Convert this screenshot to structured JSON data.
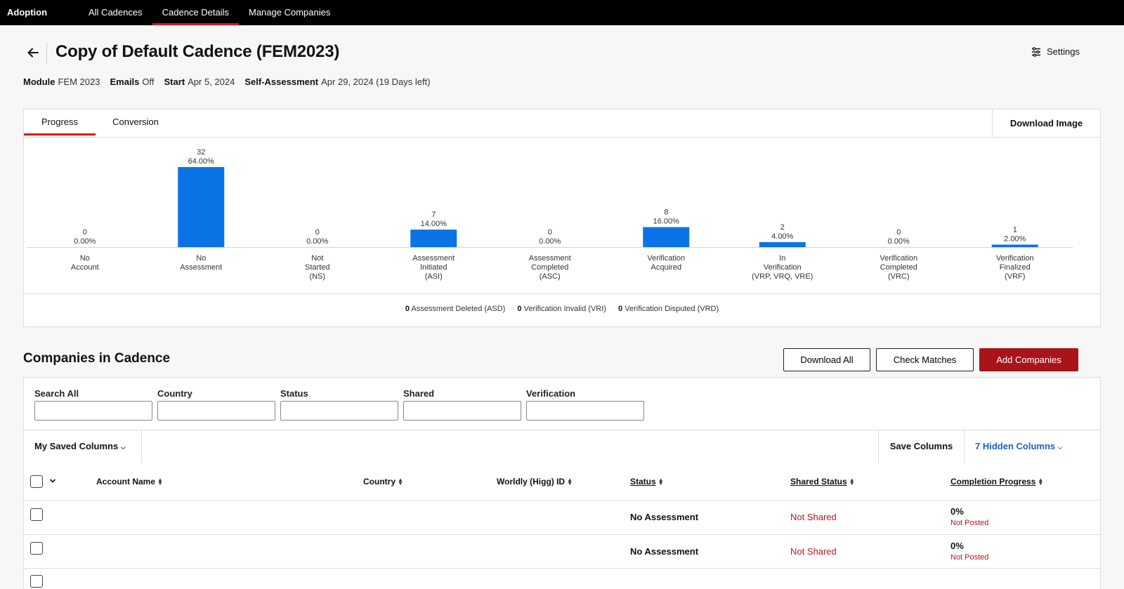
{
  "nav": {
    "brand": "Adoption",
    "tabs": [
      "All Cadences",
      "Cadence Details",
      "Manage Companies"
    ],
    "active": 1
  },
  "header": {
    "title": "Copy of Default Cadence (FEM2023)",
    "settings_label": "Settings",
    "meta": [
      {
        "label": "Module",
        "value": "FEM 2023"
      },
      {
        "label": "Emails",
        "value": "Off"
      },
      {
        "label": "Start",
        "value": "Apr 5, 2024"
      },
      {
        "label": "Self-Assessment",
        "value": "Apr 29, 2024 (19 Days left)"
      }
    ]
  },
  "chart_card": {
    "tabs": [
      "Progress",
      "Conversion"
    ],
    "active_tab": 0,
    "download_image_label": "Download Image",
    "footer": [
      {
        "count": "0",
        "label": "Assessment Deleted (ASD)"
      },
      {
        "count": "0",
        "label": "Verification Invalid (VRI)"
      },
      {
        "count": "0",
        "label": "Verification Disputed (VRD)"
      }
    ]
  },
  "chart_data": {
    "type": "bar",
    "categories": [
      [
        "No",
        "Account"
      ],
      [
        "No",
        "Assessment"
      ],
      [
        "Not",
        "Started",
        "(NS)"
      ],
      [
        "Assessment",
        "Initiated",
        "(ASI)"
      ],
      [
        "Assessment",
        "Completed",
        "(ASC)"
      ],
      [
        "Verification",
        "Acquired"
      ],
      [
        "In",
        "Verification",
        "(VRP, VRQ, VRE)"
      ],
      [
        "Verification",
        "Completed",
        "(VRC)"
      ],
      [
        "Verification",
        "Finalized",
        "(VRF)"
      ]
    ],
    "values": [
      0,
      32,
      0,
      7,
      0,
      8,
      2,
      0,
      1
    ],
    "percent_labels": [
      "0.00%",
      "64.00%",
      "0.00%",
      "14.00%",
      "0.00%",
      "16.00%",
      "4.00%",
      "0.00%",
      "2.00%"
    ],
    "bar_color": "#0a74e6",
    "ylim": [
      0,
      32
    ],
    "grid": false,
    "legend": "none"
  },
  "companies": {
    "title": "Companies in Cadence",
    "buttons": {
      "download_all": "Download All",
      "check_matches": "Check Matches",
      "add_companies": "Add Companies"
    },
    "filters": [
      "Search All",
      "Country",
      "Status",
      "Shared",
      "Verification"
    ],
    "toolbar": {
      "saved_columns": "My Saved Columns",
      "save_columns": "Save Columns",
      "hidden_columns": "7 Hidden Columns"
    },
    "columns": [
      "Account Name",
      "Country",
      "Worldly (Higg) ID",
      "Status",
      "Shared Status",
      "Completion Progress"
    ],
    "rows": [
      {
        "status": "No Assessment",
        "shared": "Not Shared",
        "progress": "0%",
        "posted": "Not Posted"
      },
      {
        "status": "No Assessment",
        "shared": "Not Shared",
        "progress": "0%",
        "posted": "Not Posted"
      }
    ]
  },
  "colors": {
    "accent_red": "#e4141b",
    "primary_button": "#a8141a",
    "link_blue": "#1a5fc9",
    "bar_blue": "#0a74e6"
  }
}
